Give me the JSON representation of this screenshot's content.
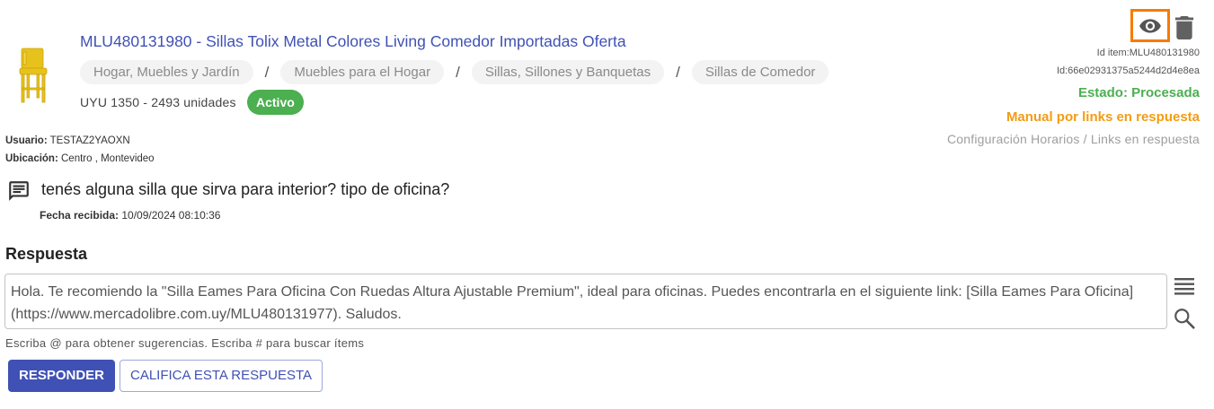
{
  "item": {
    "title": "MLU480131980 - Sillas Tolix Metal Colores Living Comedor Importadas Oferta",
    "breadcrumb": [
      "Hogar, Muebles y Jardín",
      "Muebles para el Hogar",
      "Sillas, Sillones y Banquetas",
      "Sillas de Comedor"
    ],
    "breadcrumb_separator": "/",
    "stock_text": "UYU 1350 - 2493 unidades",
    "status_badge": "Activo"
  },
  "meta": {
    "usuario_label": "Usuario:",
    "usuario_value": "TESTAZ2YAOXN",
    "ubicacion_label": "Ubicación:",
    "ubicacion_value": "Centro , Montevideo"
  },
  "side": {
    "id_item": "Id item:MLU480131980",
    "id": "Id:66e02931375a5244d2d4e8ea",
    "estado": "Estado: Procesada",
    "manual": "Manual por links en respuesta",
    "config_horarios": "Configuración Horarios",
    "link_separator": " / ",
    "links_respuesta": "Links en respuesta"
  },
  "question": {
    "text": "tenés alguna silla que sirva para interior? tipo de oficina?",
    "fecha_label": "Fecha recibida:",
    "fecha_value": "10/09/2024 08:10:36"
  },
  "answer": {
    "label": "Respuesta",
    "text": "Hola. Te recomiendo la \"Silla Eames Para Oficina Con Ruedas Altura Ajustable Premium\", ideal para oficinas. Puedes encontrarla en el siguiente link: [Silla Eames Para Oficina](https://www.mercadolibre.com.uy/MLU480131977). Saludos.",
    "hint": "Escriba @ para obtener sugerencias. Escriba # para buscar ítems"
  },
  "buttons": {
    "responder": "RESPONDER",
    "califica": "CALIFICA ESTA RESPUESTA"
  },
  "colors": {
    "primary": "#3f51b5",
    "success": "#4caf50",
    "warning": "#f39c12",
    "highlight": "#f57c00"
  },
  "icons": {
    "thumbnail": "yellow-chair-thumbnail",
    "view": "eye-icon",
    "delete": "trash-icon",
    "message": "chat-message-icon",
    "menu": "list-lines-icon",
    "search": "search-icon"
  }
}
